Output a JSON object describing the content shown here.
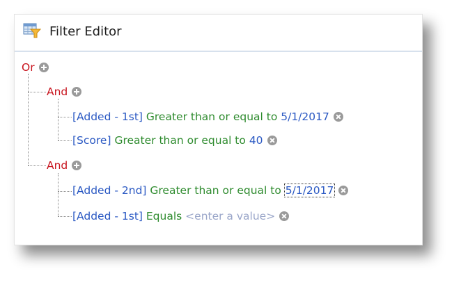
{
  "window": {
    "title": "Filter Editor",
    "icon": "filter-editor-icon"
  },
  "tree": {
    "root_operator": "Or",
    "groups": [
      {
        "operator": "And",
        "conditions": [
          {
            "field": "[Added - 1st]",
            "operator": "Greater than or equal to",
            "value": "5/1/2017"
          },
          {
            "field": "[Score]",
            "operator": "Greater than or equal to",
            "value": "40"
          }
        ]
      },
      {
        "operator": "And",
        "conditions": [
          {
            "field": "[Added - 2nd]",
            "operator": "Greater than or equal to",
            "value": "5/1/2017"
          },
          {
            "field": "[Added - 1st]",
            "operator": "Equals",
            "placeholder": "<enter a value>"
          }
        ]
      }
    ]
  },
  "colors": {
    "operator_group": "#c8141e",
    "field": "#2b59c3",
    "condition": "#2e8b2e",
    "placeholder": "#9aa6c9"
  }
}
